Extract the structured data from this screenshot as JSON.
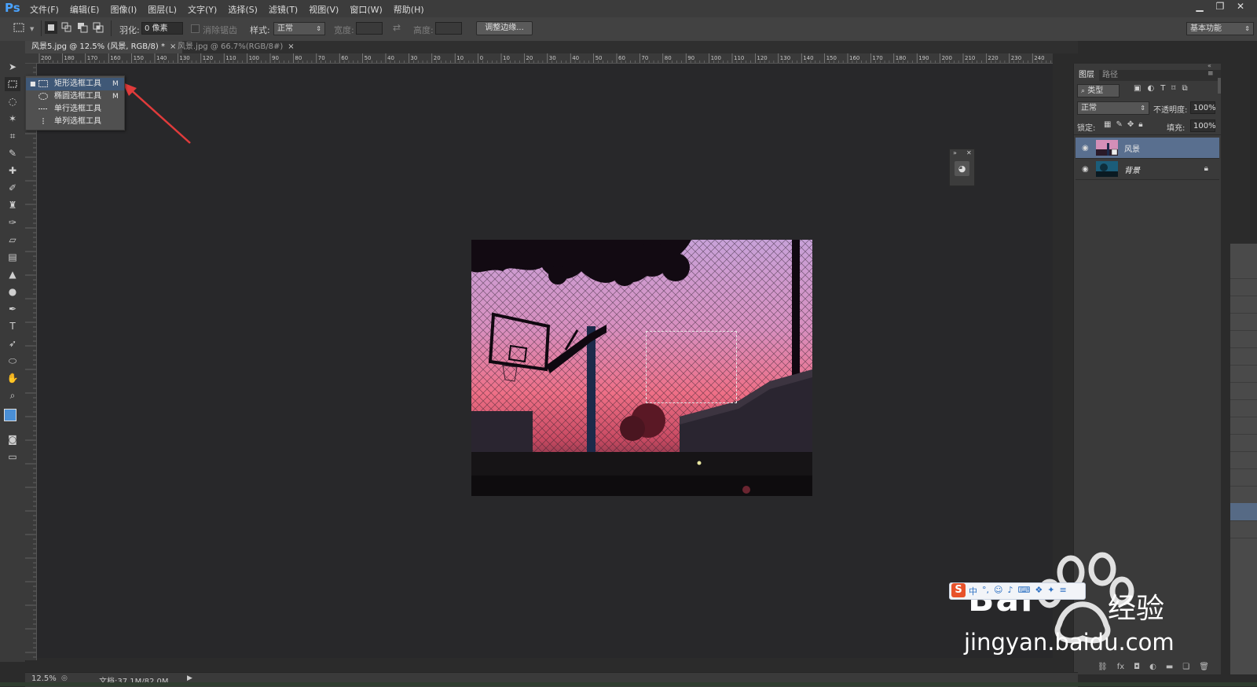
{
  "app": {
    "logo": "Ps"
  },
  "menu": [
    "文件(F)",
    "编辑(E)",
    "图像(I)",
    "图层(L)",
    "文字(Y)",
    "选择(S)",
    "滤镜(T)",
    "视图(V)",
    "窗口(W)",
    "帮助(H)"
  ],
  "options": {
    "feather_label": "羽化:",
    "feather_value": "0 像素",
    "antialias_label": "消除锯齿",
    "style_label": "样式:",
    "style_value": "正常",
    "width_label": "宽度:",
    "height_label": "高度:",
    "refine_edge": "调整边缘...",
    "workspace": "基本功能"
  },
  "tabs": [
    {
      "label": "风景5.jpg @ 12.5% (风景, RGB/8) *",
      "active": true
    },
    {
      "label": "风景.jpg @ 66.7%(RGB/8#)",
      "active": false
    }
  ],
  "ruler_labels": [
    "200",
    "180",
    "170",
    "160",
    "150",
    "140",
    "130",
    "120",
    "110",
    "100",
    "90",
    "80",
    "70",
    "60",
    "50",
    "40",
    "30",
    "20",
    "10",
    "0",
    "10",
    "20",
    "30",
    "40",
    "50",
    "60",
    "70",
    "80",
    "90",
    "100",
    "110",
    "120",
    "130",
    "140",
    "150",
    "160",
    "170",
    "180",
    "190",
    "200",
    "210",
    "220",
    "230",
    "240",
    "250",
    "260",
    "270",
    "280",
    "290",
    "300",
    "310",
    "320"
  ],
  "flyout": [
    {
      "label": "矩形选框工具",
      "key": "M",
      "icon": "rect-marquee-icon",
      "selected": true
    },
    {
      "label": "椭圆选框工具",
      "key": "M",
      "icon": "ellipse-marquee-icon",
      "selected": false
    },
    {
      "label": "单行选框工具",
      "key": "",
      "icon": "single-row-marquee-icon",
      "selected": false
    },
    {
      "label": "单列选框工具",
      "key": "",
      "icon": "single-column-marquee-icon",
      "selected": false
    }
  ],
  "layers_panel": {
    "tabs": [
      "图层",
      "路径"
    ],
    "filter_label": "类型",
    "blend_mode": "正常",
    "opacity_label": "不透明度:",
    "opacity_value": "100%",
    "lock_label": "锁定:",
    "fill_label": "填充:",
    "fill_value": "100%",
    "layers": [
      {
        "name": "风景",
        "selected": true,
        "locked": false
      },
      {
        "name": "背景",
        "selected": false,
        "locked": true
      }
    ]
  },
  "status": {
    "zoom": "12.5%",
    "doc": "文档:37.1M/82.0M"
  },
  "watermark": {
    "brand": "Bai",
    "brand_cn": "经验",
    "url": "jingyan.baidu.com"
  },
  "colors": {
    "accent": "#4aa3ff",
    "selection": "#3f5877",
    "layer_selected": "#596f8f"
  }
}
